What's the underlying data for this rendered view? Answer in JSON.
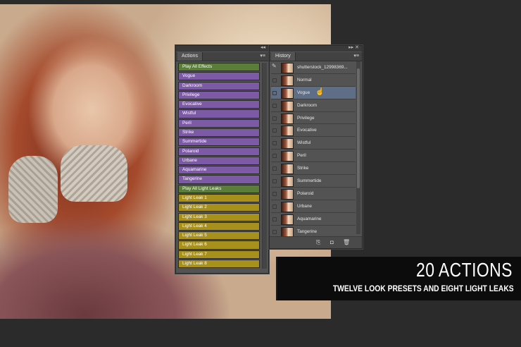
{
  "actions_panel": {
    "tab_label": "Actions",
    "menu_icon": "panel-menu-icon",
    "items": [
      {
        "label": "Play All Effects",
        "color": "#5a7d3a"
      },
      {
        "label": "Vogue",
        "color": "#7d5aa6"
      },
      {
        "label": "Darkroom",
        "color": "#7d5aa6"
      },
      {
        "label": "Privilege",
        "color": "#7d5aa6"
      },
      {
        "label": "Evocative",
        "color": "#7d5aa6"
      },
      {
        "label": "Wistful",
        "color": "#7d5aa6"
      },
      {
        "label": "Peril",
        "color": "#7d5aa6"
      },
      {
        "label": "Strike",
        "color": "#7d5aa6"
      },
      {
        "label": "Summertide",
        "color": "#7d5aa6"
      },
      {
        "label": "Polaroid",
        "color": "#7d5aa6"
      },
      {
        "label": "Urbane",
        "color": "#7d5aa6"
      },
      {
        "label": "Aquamarine",
        "color": "#7d5aa6"
      },
      {
        "label": "Tangerine",
        "color": "#7d5aa6"
      },
      {
        "label": "Play All Light Leaks",
        "color": "#5a7d3a"
      },
      {
        "label": "Light Leak 1",
        "color": "#a8901c"
      },
      {
        "label": "Light Leak 2",
        "color": "#a8901c"
      },
      {
        "label": "Light Leak 3",
        "color": "#a8901c"
      },
      {
        "label": "Light Leak 4",
        "color": "#a8901c"
      },
      {
        "label": "Light Leak 5",
        "color": "#a8901c"
      },
      {
        "label": "Light Leak 6",
        "color": "#a8901c"
      },
      {
        "label": "Light Leak 7",
        "color": "#a8901c"
      },
      {
        "label": "Light Leak 8",
        "color": "#a8901c"
      }
    ]
  },
  "history_panel": {
    "tab_label": "History",
    "menu_icon": "panel-menu-icon",
    "items": [
      {
        "label": "shutterstock_12998369..."
      },
      {
        "label": "Normal"
      },
      {
        "label": "Vogue",
        "selected": true
      },
      {
        "label": "Darkroom"
      },
      {
        "label": "Privilege"
      },
      {
        "label": "Evocative"
      },
      {
        "label": "Wistful"
      },
      {
        "label": "Peril"
      },
      {
        "label": "Strike"
      },
      {
        "label": "Summertide"
      },
      {
        "label": "Polaroid"
      },
      {
        "label": "Urbane"
      },
      {
        "label": "Aquamarine"
      },
      {
        "label": "Tangerine"
      }
    ],
    "footer_icons": [
      "new-document-from-state-icon",
      "snapshot-camera-icon",
      "trash-icon"
    ]
  },
  "banner": {
    "headline": "20 ACTIONS",
    "subline": "TWELVE LOOK PRESETS AND EIGHT LIGHT LEAKS"
  },
  "colors": {
    "background": "#2b2b2b",
    "panel": "#535353",
    "selected_row": "#5d6e86",
    "banner": "#0c0c0c"
  }
}
